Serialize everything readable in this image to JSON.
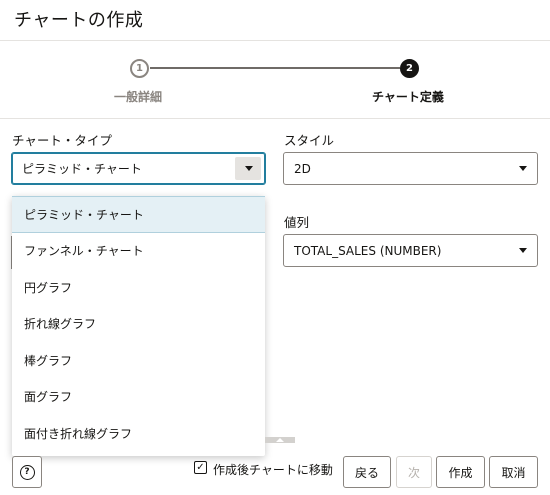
{
  "dialog": {
    "title": "チャートの作成"
  },
  "train": {
    "steps": [
      {
        "number": "1",
        "label": "一般詳細"
      },
      {
        "number": "2",
        "label": "チャート定義"
      }
    ]
  },
  "chart_type": {
    "label": "チャート・タイプ",
    "value": "ピラミッド・チャート",
    "options": [
      "ピラミッド・チャート",
      "ファンネル・チャート",
      "円グラフ",
      "折れ線グラフ",
      "棒グラフ",
      "面グラフ",
      "面付き折れ線グラフ"
    ]
  },
  "style": {
    "label": "スタイル",
    "value": "2D"
  },
  "value_column": {
    "label": "値列",
    "value": "TOTAL_SALES (NUMBER)"
  },
  "footer": {
    "help_glyph": "?",
    "checkbox_checked": true,
    "checkbox_label": "作成後チャートに移動",
    "back_label": "戻る",
    "next_label": "次",
    "create_label": "作成",
    "cancel_label": "取消"
  },
  "colors": {
    "accent": "#227e9e",
    "selected_bg": "#e4f0f5"
  }
}
